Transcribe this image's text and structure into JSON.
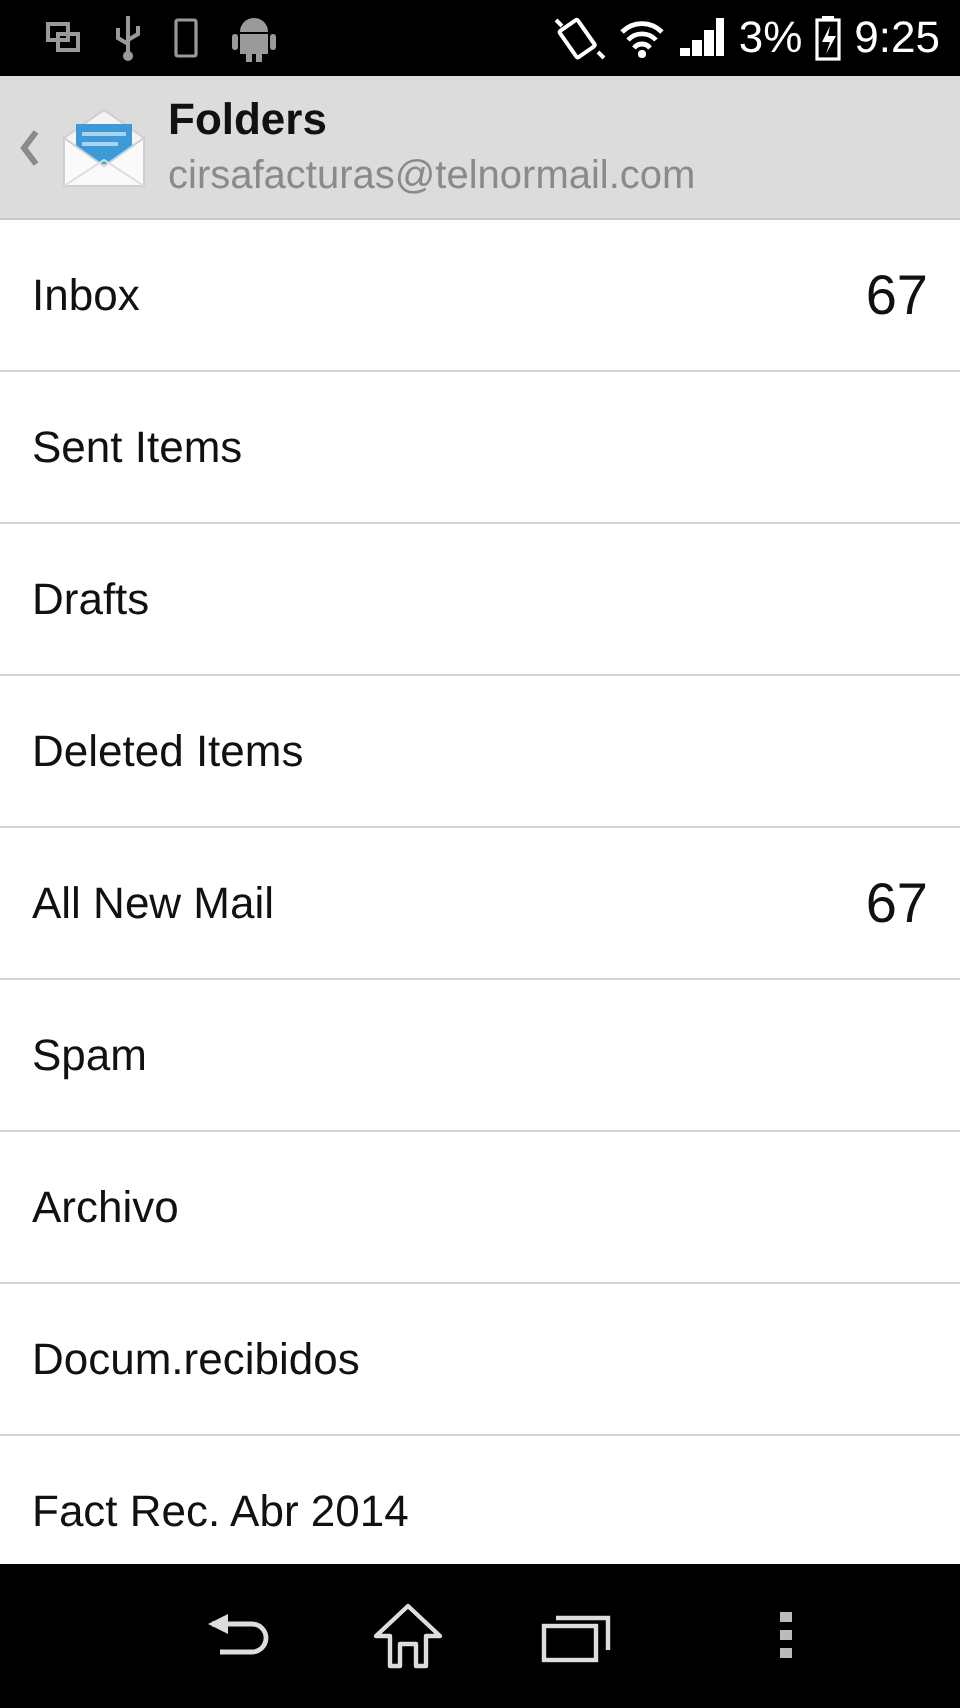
{
  "status_bar": {
    "battery_percent": "3%",
    "time": "9:25"
  },
  "header": {
    "title": "Folders",
    "account": "cirsafacturas@telnormail.com"
  },
  "folders": [
    {
      "name": "Inbox",
      "count": "67"
    },
    {
      "name": "Sent Items"
    },
    {
      "name": "Drafts"
    },
    {
      "name": "Deleted Items"
    },
    {
      "name": "All New Mail",
      "count": "67"
    },
    {
      "name": "Spam"
    },
    {
      "name": "Archivo"
    },
    {
      "name": "Docum.recibidos"
    },
    {
      "name": "Fact Rec. Abr 2014"
    }
  ]
}
